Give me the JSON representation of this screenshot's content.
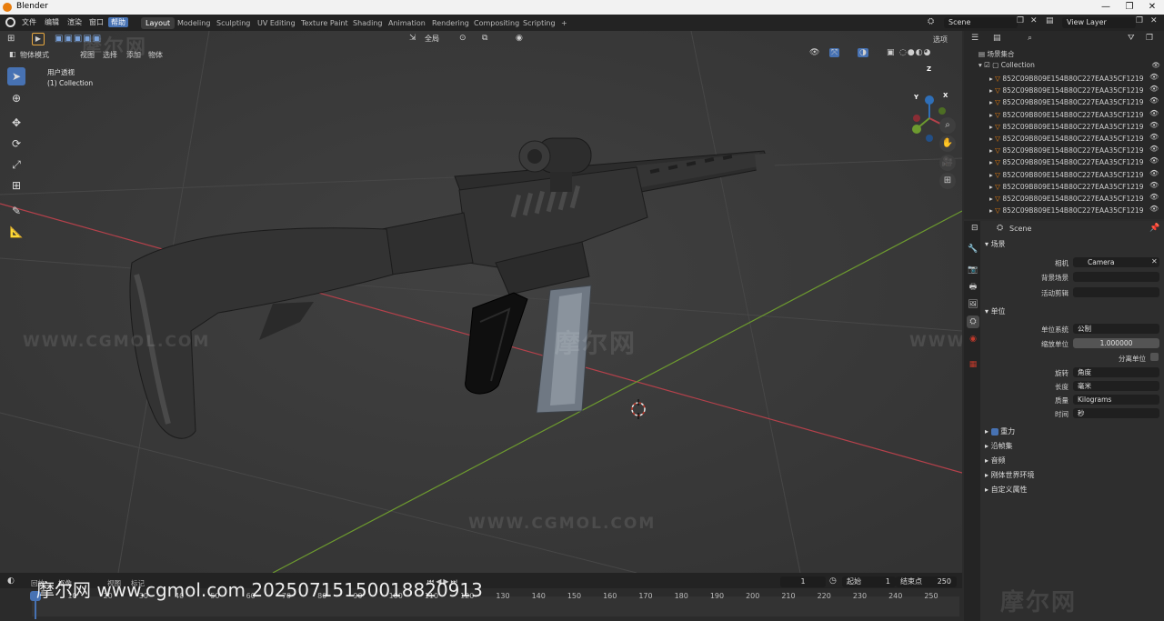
{
  "titlebar": {
    "title": "Blender",
    "minimize": "—",
    "maximize": "❐",
    "close": "✕"
  },
  "menu": {
    "items": [
      "文件",
      "编辑",
      "渲染",
      "窗口",
      "帮助"
    ]
  },
  "workspaces": [
    "Layout",
    "Modeling",
    "Sculpting",
    "UV Editing",
    "Texture Paint",
    "Shading",
    "Animation",
    "Rendering",
    "Compositing",
    "Scripting"
  ],
  "workspace_add": "+",
  "scene_field": "Scene",
  "view_layer_field": "View Layer",
  "viewport": {
    "mode": "物体模式",
    "menus": [
      "视图",
      "选择",
      "添加",
      "物体"
    ],
    "transform_orientation": "全局",
    "options": "选项",
    "overlay_line1": "用户透视",
    "overlay_line2": "(1) Collection"
  },
  "gizmo": {
    "z": "Z",
    "y": "Y",
    "x": "X"
  },
  "outliner": {
    "root": "场景集合",
    "collection": "Collection",
    "objects": [
      "852C09B809E154B80C227EAA35CF1219",
      "852C09B809E154B80C227EAA35CF1219",
      "852C09B809E154B80C227EAA35CF1219",
      "852C09B809E154B80C227EAA35CF1219",
      "852C09B809E154B80C227EAA35CF1219",
      "852C09B809E154B80C227EAA35CF1219",
      "852C09B809E154B80C227EAA35CF1219",
      "852C09B809E154B80C227EAA35CF1219",
      "852C09B809E154B80C227EAA35CF1219",
      "852C09B809E154B80C227EAA35CF1219",
      "852C09B809E154B80C227EAA35CF1219",
      "852C09B809E154B80C227EAA35CF1219"
    ]
  },
  "properties": {
    "context": "Scene",
    "scene_section": "场景",
    "camera_label": "相机",
    "camera_value": "Camera",
    "background_label": "背景场景",
    "active_clip_label": "活动剪辑",
    "units_section": "单位",
    "unit_system_label": "单位系统",
    "unit_system_value": "公制",
    "unit_scale_label": "缩放单位",
    "unit_scale_value": "1.000000",
    "separate_units_label": "分离单位",
    "rotation_label": "旋转",
    "rotation_value": "角度",
    "length_label": "长度",
    "length_value": "毫米",
    "mass_label": "质量",
    "mass_value": "Kilograms",
    "time_label": "时间",
    "time_value": "秒",
    "gravity_label": "重力",
    "collapsed_sections": [
      "沿帧集",
      "音频",
      "刚体世界环境",
      "自定义属性"
    ]
  },
  "timeline": {
    "current_frame": "1",
    "start_label": "起始",
    "start_value": "1",
    "end_label": "结束点",
    "end_value": "250",
    "ticks": [
      "1",
      "10",
      "20",
      "30",
      "40",
      "50",
      "60",
      "70",
      "80",
      "90",
      "100",
      "110",
      "120",
      "130",
      "140",
      "150",
      "160",
      "170",
      "180",
      "190",
      "200",
      "210",
      "220",
      "230",
      "240",
      "250"
    ],
    "menus": [
      "回放",
      "抠像",
      "视图",
      "标记"
    ]
  },
  "watermarks": {
    "site_url": "WWW.CGMOL.COM",
    "brand": "摩尔网",
    "footer": "摩尔网 www.cgmol.com 20250715150018820913"
  },
  "colors": {
    "accent": "#4772b3",
    "x_axis": "#b5414b",
    "y_axis": "#6d9a2f",
    "object_icon": "#e87d0d"
  }
}
